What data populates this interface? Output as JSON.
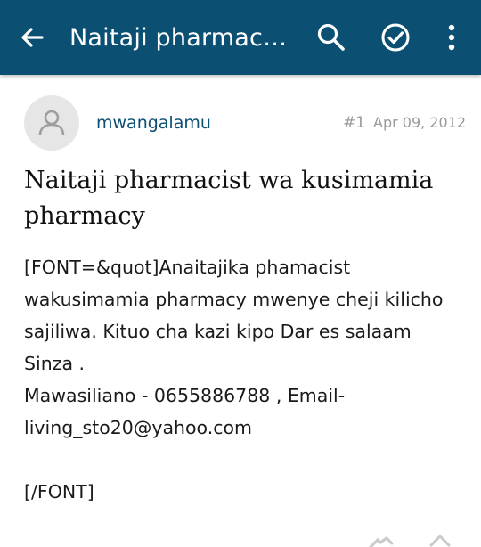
{
  "appbar": {
    "title": "Naitaji pharmacis...",
    "background": "#0b4f73",
    "icons": [
      "back-arrow-icon",
      "search-icon",
      "check-circle-icon",
      "more-vert-icon"
    ]
  },
  "post": {
    "username": "mwangalamu",
    "number": "#1",
    "date": "Apr 09, 2012",
    "title": "Naitaji  pharmacist wa kusimamia pharmacy",
    "body_lines": [
      "[FONT=&quot]Anaitajika phamacist",
      "wakusimamia pharmacy mwenye cheji kilicho",
      "sajiliwa. Kituo cha kazi kipo Dar es salaam",
      "Sinza .",
      "Mawasiliano - 0655886788 , Email-",
      "living_sto20@yahoo.com",
      "",
      "[/FONT]"
    ]
  },
  "footer_icons": [
    "thanks-icon",
    "reply-icon"
  ]
}
